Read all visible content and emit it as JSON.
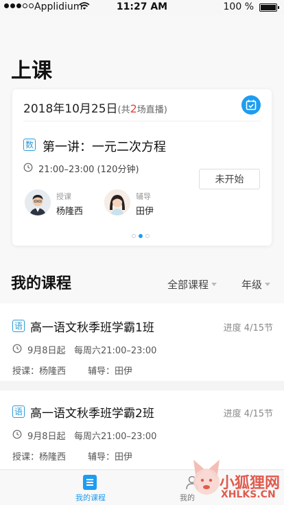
{
  "status_bar": {
    "carrier": "Applidium",
    "time": "11:27 AM",
    "battery": "100 %"
  },
  "page_title": "上课",
  "lesson_card": {
    "date": "2018年10月25日",
    "live_prefix": "(共",
    "live_count": "2",
    "live_suffix": "场直播)",
    "subject_badge": "数",
    "lesson_title": "第一讲：一元二次方程",
    "time": "21:00–23:00 (120分钟)",
    "status_button": "未开始",
    "teacher": {
      "role": "授课",
      "name": "杨隆西"
    },
    "tutor": {
      "role": "辅导",
      "name": "田伊"
    },
    "pages": 3,
    "current_page": 2
  },
  "my_courses": {
    "title": "我的课程",
    "filters": {
      "all": "全部课程",
      "grade": "年级"
    },
    "items": [
      {
        "badge": "语",
        "title": "高一语文秋季班学霸1班",
        "progress": "进度 4/15节",
        "schedule": "9月8日起   每周六21:00–23:00",
        "teacher": "授课：杨隆西",
        "tutor": "辅导：田伊"
      },
      {
        "badge": "语",
        "title": "高一语文秋季班学霸2班",
        "progress": "进度 4/15节",
        "schedule": "9月8日起   每周六21:00–23:00",
        "teacher": "授课：杨隆西",
        "tutor": "辅导：田伊"
      }
    ]
  },
  "tabbar": {
    "courses": "我的课程",
    "mine": "我的"
  },
  "watermark": {
    "cn": "小狐狸网",
    "en": "XHLKS.CN"
  },
  "colors": {
    "accent": "#1e9cf0",
    "highlight": "#e0443a",
    "watermark": "#e05a4e"
  }
}
